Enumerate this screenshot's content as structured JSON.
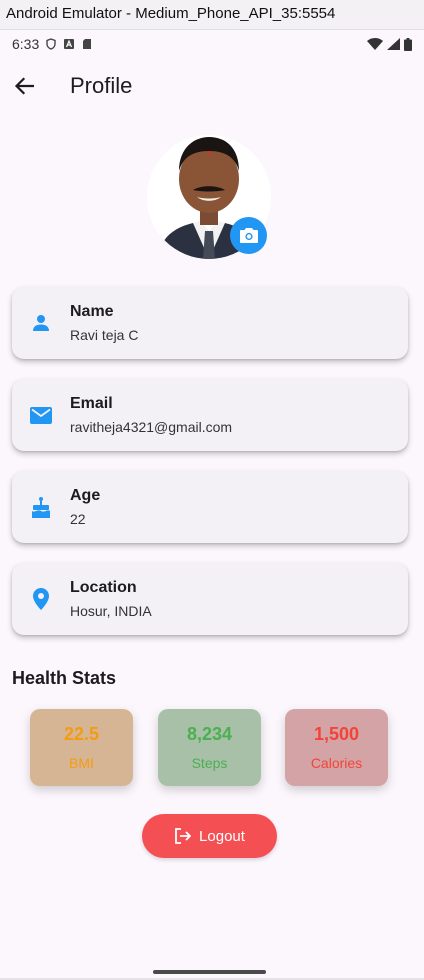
{
  "window": {
    "title": "Android Emulator - Medium_Phone_API_35:5554"
  },
  "status_bar": {
    "time": "6:33"
  },
  "app_bar": {
    "title": "Profile"
  },
  "profile_cards": [
    {
      "label": "Name",
      "value": "Ravi teja C",
      "icon": "person-icon"
    },
    {
      "label": "Email",
      "value": "ravitheja4321@gmail.com",
      "icon": "email-icon"
    },
    {
      "label": "Age",
      "value": "22",
      "icon": "cake-icon"
    },
    {
      "label": "Location",
      "value": "Hosur, INDIA",
      "icon": "location-icon"
    }
  ],
  "health": {
    "title": "Health Stats",
    "stats": [
      {
        "value": "22.5",
        "label": "BMI",
        "color": "#f39c12",
        "bg": "#d6b594"
      },
      {
        "value": "8,234",
        "label": "Steps",
        "color": "#4caf50",
        "bg": "#a8c0a8"
      },
      {
        "value": "1,500",
        "label": "Calories",
        "color": "#f44336",
        "bg": "#d3a3a6"
      }
    ]
  },
  "logout": {
    "label": "Logout"
  },
  "colors": {
    "accent": "#2196f3",
    "logout": "#f44f53",
    "background": "#fbf7fd"
  }
}
